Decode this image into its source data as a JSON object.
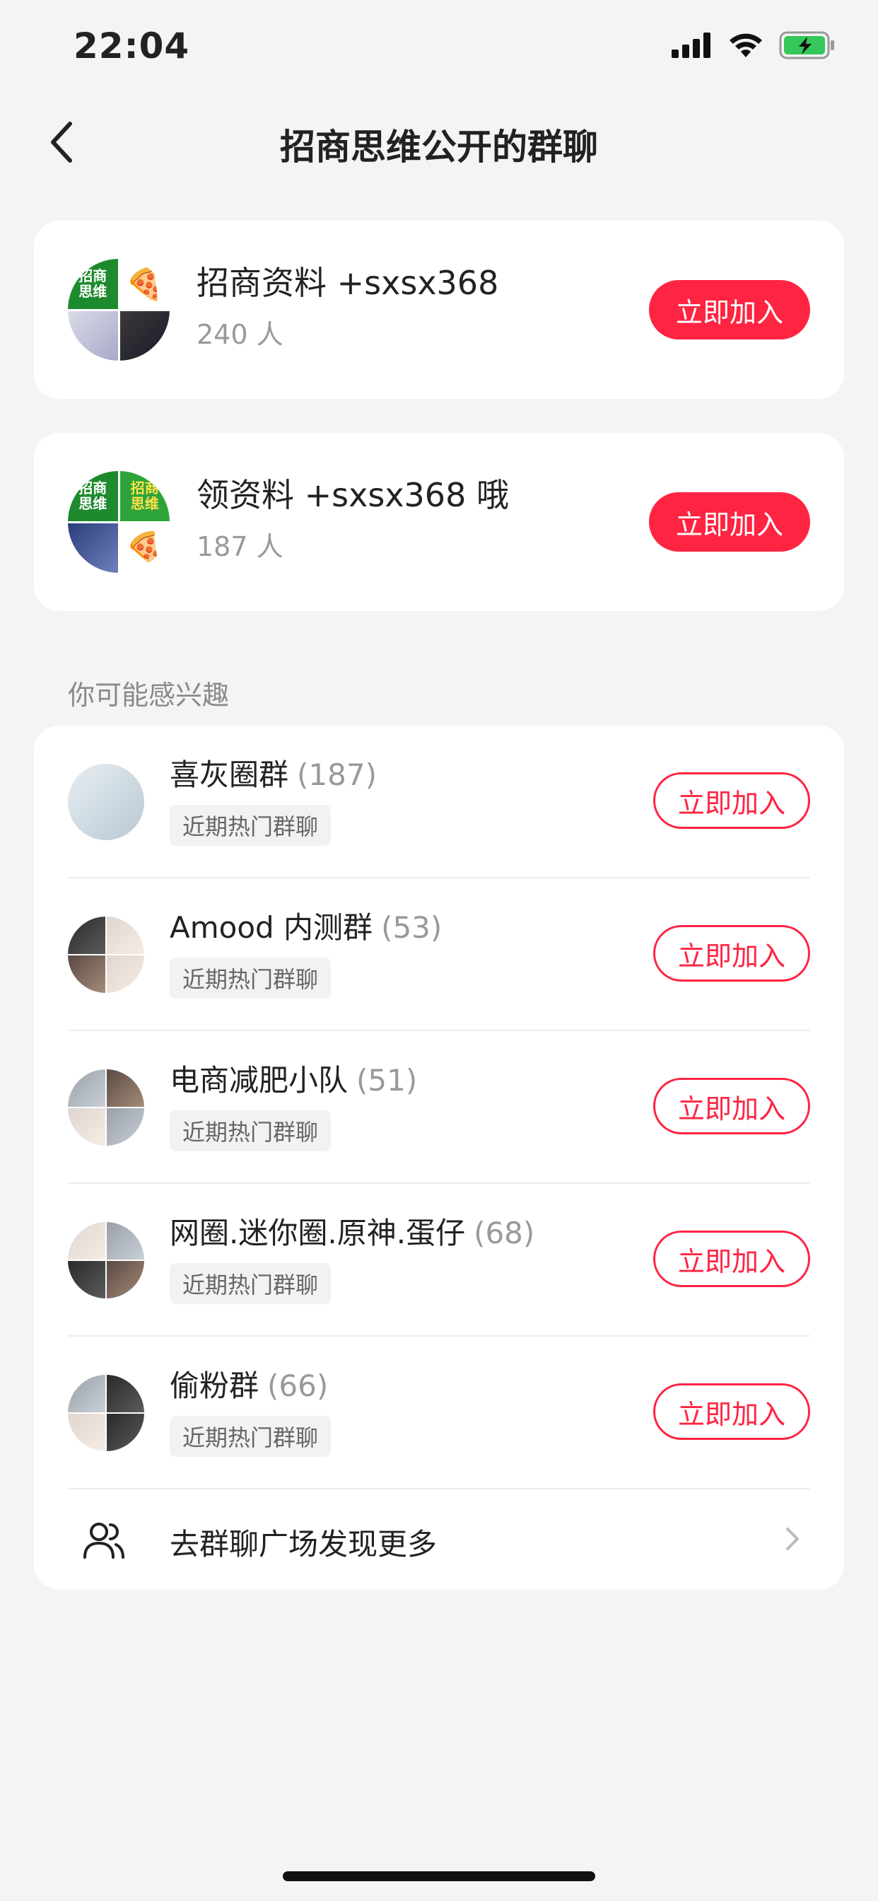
{
  "status_bar": {
    "time": "22:04"
  },
  "header": {
    "title": "招商思维公开的群聊"
  },
  "groups": [
    {
      "name": "招商资料 +sxsx368",
      "member_count": "240 人",
      "join_label": "立即加入",
      "logo_text": "招商\n思维"
    },
    {
      "name": "领资料 +sxsx368 哦",
      "member_count": "187 人",
      "join_label": "立即加入",
      "logo_text": "招商\n思维",
      "logo_text_2": "招商\n思维"
    }
  ],
  "recommend": {
    "section_title": "你可能感兴趣",
    "items": [
      {
        "name": "喜灰圈群",
        "count": "(187)",
        "tag": "近期热门群聊",
        "join_label": "立即加入"
      },
      {
        "name": "Amood 内测群",
        "count": "(53)",
        "tag": "近期热门群聊",
        "join_label": "立即加入"
      },
      {
        "name": "电商减肥小队",
        "count": "(51)",
        "tag": "近期热门群聊",
        "join_label": "立即加入"
      },
      {
        "name": "网圈.迷你圈.原神.蛋仔",
        "count": "(68)",
        "tag": "近期热门群聊",
        "join_label": "立即加入"
      },
      {
        "name": "偷粉群",
        "count": "(66)",
        "tag": "近期热门群聊",
        "join_label": "立即加入"
      }
    ],
    "discover_label": "去群聊广场发现更多"
  },
  "colors": {
    "accent": "#ff2442",
    "background": "#f4f4f4"
  },
  "icons": {
    "back": "chevron-left-icon",
    "signal": "cellular-signal-icon",
    "wifi": "wifi-icon",
    "battery": "battery-charging-icon",
    "group": "people-icon",
    "more": "chevron-right-icon"
  }
}
